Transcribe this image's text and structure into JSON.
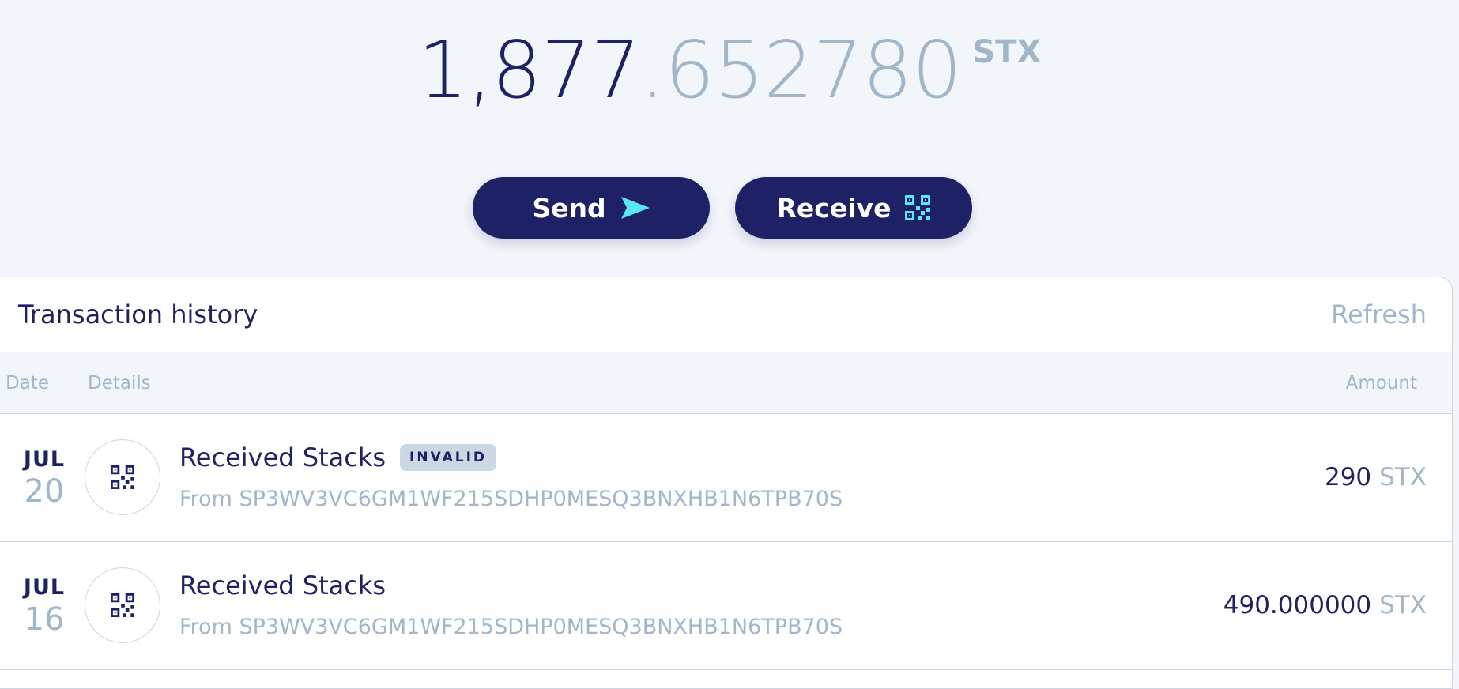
{
  "balance": {
    "whole": "1,877",
    "fraction": ".652780",
    "unit": "STX"
  },
  "actions": {
    "send_label": "Send",
    "receive_label": "Receive"
  },
  "history": {
    "title": "Transaction history",
    "refresh_label": "Refresh",
    "columns": {
      "date": "Date",
      "details": "Details",
      "amount": "Amount"
    },
    "transactions": [
      {
        "month": "JUL",
        "day": "20",
        "title": "Received Stacks",
        "badge": "INVALID",
        "from": "From SP3WV3VC6GM1WF215SDHP0MESQ3BNXHB1N6TPB70S",
        "amount": "290",
        "unit": "STX"
      },
      {
        "month": "JUL",
        "day": "16",
        "title": "Received Stacks",
        "from": "From SP3WV3VC6GM1WF215SDHP0MESQ3BNXHB1N6TPB70S",
        "amount": "490.000000",
        "unit": "STX"
      }
    ]
  },
  "icons": {
    "send": "paper-plane-icon",
    "receive": "qr-code-icon",
    "transaction": "qr-code-icon"
  },
  "colors": {
    "primary": "#1e2166",
    "muted": "#a2b6c9",
    "accent": "#5ae6f2",
    "background": "#f2f5f9",
    "border": "#c9d8e3"
  }
}
